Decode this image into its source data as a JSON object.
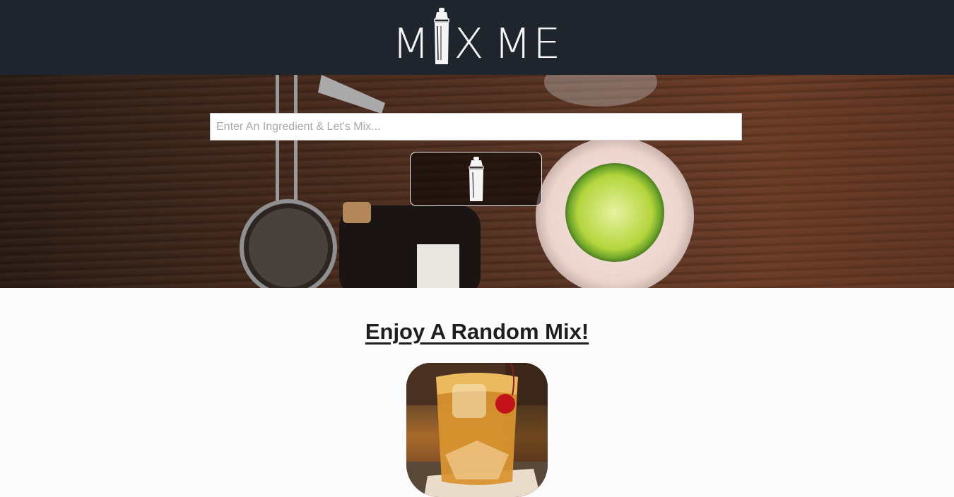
{
  "header": {
    "logo_text_left": "M",
    "logo_text_mid": "X",
    "logo_text_right": "ME"
  },
  "hero": {
    "search_placeholder": "Enter An Ingredient & Let's Mix...",
    "search_value": ""
  },
  "random": {
    "title": "Enjoy A Random Mix!"
  },
  "colors": {
    "header_bg": "#1f252d",
    "page_bg": "#fbfbfb"
  }
}
